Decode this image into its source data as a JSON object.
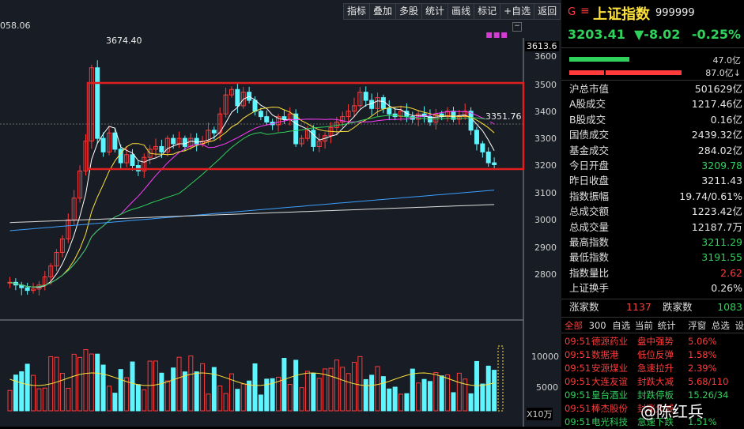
{
  "toolbar": [
    "指标",
    "叠加",
    "多股",
    "统计",
    "画线",
    "标记",
    "+自选",
    "返回"
  ],
  "chart": {
    "high_label": "3674.40",
    "top_left_label": "058.06",
    "mark_label": "3613.6",
    "box_label": "3351.76",
    "price_ticks": [
      "3600",
      "3500",
      "3400",
      "3300",
      "3200",
      "3100",
      "3000",
      "2900",
      "2800"
    ],
    "vol_ticks": [
      "10000",
      "5000"
    ],
    "vol_unit": "X10万"
  },
  "header": {
    "g": "G",
    "menu_glyph": "≡",
    "name": "上证指数",
    "code": "999999",
    "price": "3203.41",
    "change": "▼-8.02",
    "pct": "-0.25%",
    "bar1_pct": "47.0亿",
    "bar2_pct": "87.0亿↓"
  },
  "stats": [
    {
      "k": "沪总市值",
      "v": "501629亿",
      "c": "white"
    },
    {
      "k": "A股成交",
      "v": "1217.46亿",
      "c": "white"
    },
    {
      "k": "B股成交",
      "v": "0.16亿",
      "c": "white"
    },
    {
      "k": "国债成交",
      "v": "2439.32亿",
      "c": "white"
    },
    {
      "k": "基金成交",
      "v": "284.02亿",
      "c": "white"
    },
    {
      "k": "今日开盘",
      "v": "3209.78",
      "c": "green"
    },
    {
      "k": "昨日收盘",
      "v": "3211.43",
      "c": "white"
    },
    {
      "k": "指数振幅",
      "v": "19.74/0.61%",
      "c": "white"
    },
    {
      "k": "总成交额",
      "v": "1223.42亿",
      "c": "white"
    },
    {
      "k": "总成交量",
      "v": "12187.7万",
      "c": "white"
    },
    {
      "k": "最高指数",
      "v": "3211.29",
      "c": "green"
    },
    {
      "k": "最低指数",
      "v": "3191.55",
      "c": "green"
    },
    {
      "k": "指数量比",
      "v": "2.62",
      "c": "red"
    },
    {
      "k": "上证换手",
      "v": "0.26%",
      "c": "white"
    }
  ],
  "updown": {
    "up_label": "涨家数",
    "up": "1137",
    "down_label": "跌家数",
    "down": "1083"
  },
  "news_tabs": [
    "全部",
    "300",
    "自选",
    "当前",
    "统计",
    "浮窗",
    "总选",
    "设置"
  ],
  "news": [
    {
      "t": "09:51",
      "n": "德源药业",
      "d": "盘中强势",
      "c": "5.06%",
      "color": "red"
    },
    {
      "t": "09:51",
      "n": "数据港",
      "d": "低位反弹",
      "c": "1.58%",
      "color": "red"
    },
    {
      "t": "09:51",
      "n": "安源煤业",
      "d": "急速拉升",
      "c": "2.39%",
      "color": "red"
    },
    {
      "t": "09:51",
      "n": "大连友谊",
      "d": "封跌大减",
      "c": "5.68/110",
      "color": "red"
    },
    {
      "t": "09:51",
      "n": "皇台酒业",
      "d": "封跌停板",
      "c": "15.26/34",
      "color": "green"
    },
    {
      "t": "09:51",
      "n": "棒杰股份",
      "d": "封涨大减",
      "c": "",
      "color": "red"
    },
    {
      "t": "09:51",
      "n": "电光科技",
      "d": "急速下跌",
      "c": "1.51%",
      "color": "green"
    }
  ],
  "watermark": "@陈红兵"
}
